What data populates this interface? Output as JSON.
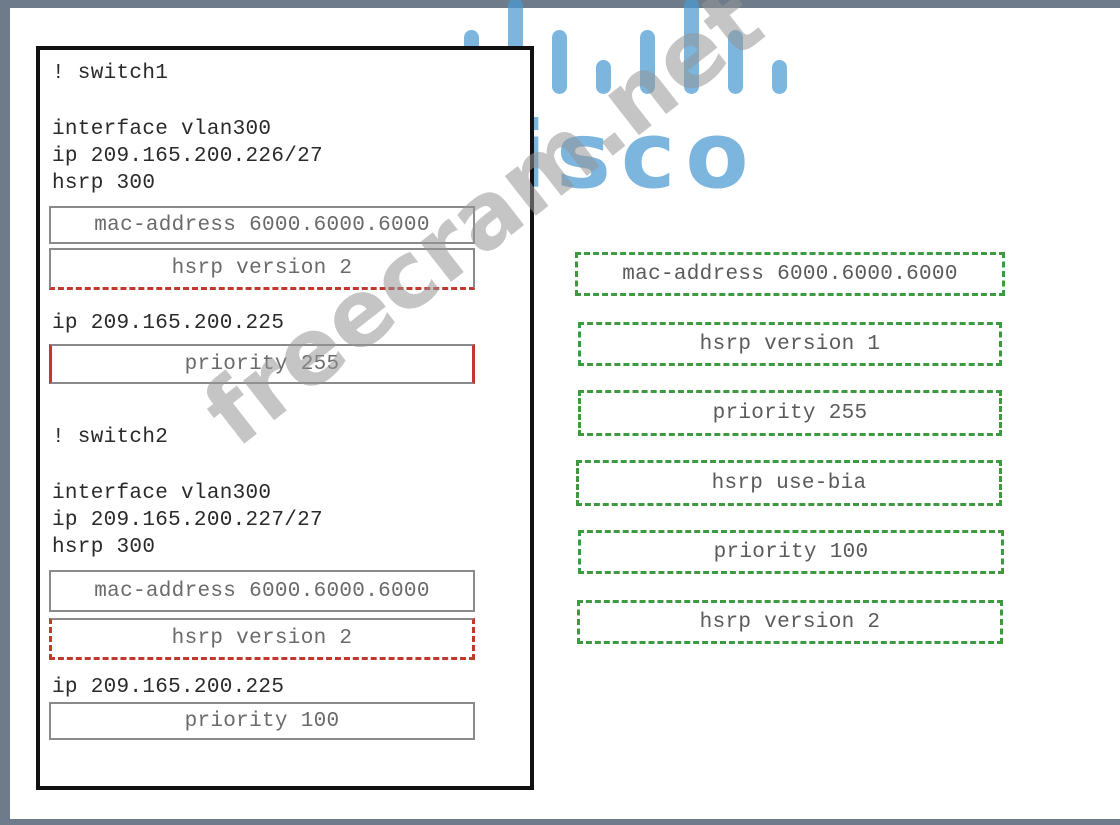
{
  "logo": {
    "text": "cisco"
  },
  "watermark": {
    "text": "freecram.net"
  },
  "switch1": {
    "comment": "! switch1",
    "interface": "interface vlan300",
    "ip_addr": "ip 209.165.200.226/27",
    "hsrp_group": "hsrp 300",
    "slot_mac": "mac-address 6000.6000.6000",
    "slot_version": "hsrp version 2",
    "virtual_ip": "ip 209.165.200.225",
    "slot_priority": "priority 255"
  },
  "switch2": {
    "comment": "! switch2",
    "interface": "interface vlan300",
    "ip_addr": "ip 209.165.200.227/27",
    "hsrp_group": "hsrp 300",
    "slot_mac": "mac-address 6000.6000.6000",
    "slot_version": "hsrp version 2",
    "virtual_ip": "ip 209.165.200.225",
    "slot_priority": "priority 100"
  },
  "options": [
    "mac-address 6000.6000.6000",
    "hsrp version 1",
    "priority 255",
    "hsrp use-bia",
    "priority 100",
    "hsrp version 2"
  ],
  "colors": {
    "frame": "#6e7b8b",
    "logo": "#4a9bd4",
    "filled_marker": "#c0392b",
    "option_border": "#3e9a3e"
  }
}
